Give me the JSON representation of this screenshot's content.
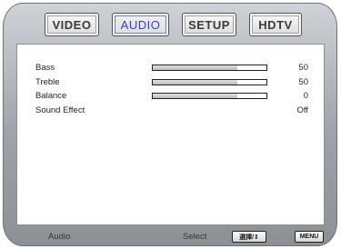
{
  "tabs": [
    {
      "label": "VIDEO",
      "active": false
    },
    {
      "label": "AUDIO",
      "active": true
    },
    {
      "label": "SETUP",
      "active": false
    },
    {
      "label": "HDTV",
      "active": false
    }
  ],
  "menu_items": [
    {
      "label": "Bass",
      "value": "50",
      "level": 0.74
    },
    {
      "label": "Treble",
      "value": "50",
      "level": 0.74
    },
    {
      "label": "Balance",
      "value": "0",
      "level": 0.74
    },
    {
      "label": "Sound Effect",
      "value": "Off"
    }
  ],
  "footer": {
    "title": "Audio",
    "hint": "Select",
    "select_key": "選擇/⇕",
    "menu_key": "MENU"
  },
  "colors": {
    "active_tab_text": "#3a3ed0",
    "frame": "#9ea2a8",
    "panel": "#ffffff"
  }
}
